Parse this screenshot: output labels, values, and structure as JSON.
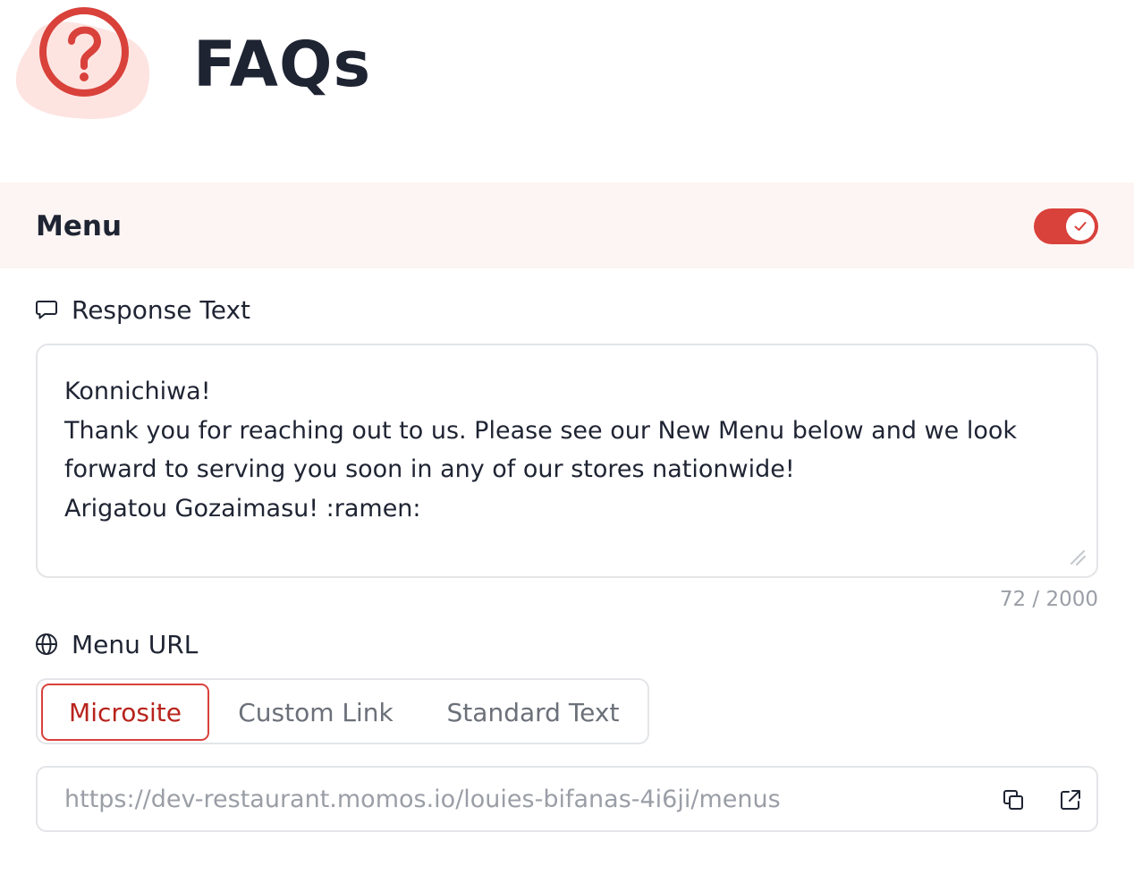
{
  "header": {
    "title": "FAQs",
    "logo_icon": "question-circle-icon"
  },
  "section": {
    "title": "Menu",
    "toggle_enabled": true
  },
  "response_text": {
    "label": "Response Text",
    "icon": "speech-bubble-icon",
    "lines": [
      "Konnichiwa!",
      "Thank you for reaching out to us. Please see our New Menu below and we look",
      "forward to serving you soon in any of our stores nationwide!",
      "Arigatou Gozaimasu! :ramen:"
    ],
    "char_count": "72 / 2000"
  },
  "menu_url": {
    "label": "Menu URL",
    "icon": "globe-icon",
    "options": [
      "Microsite",
      "Custom Link",
      "Standard Text"
    ],
    "selected": "Microsite",
    "url": "https://dev-restaurant.momos.io/louies-bifanas-4i6ji/menus",
    "actions": [
      "copy-icon",
      "external-link-icon"
    ]
  },
  "colors": {
    "accent": "#d9413b",
    "section_bg": "#fdf5f3",
    "logo_blob": "#fde4e1",
    "text": "#1f2433",
    "muted": "#9a9ea6",
    "border": "#e3e5e8"
  }
}
